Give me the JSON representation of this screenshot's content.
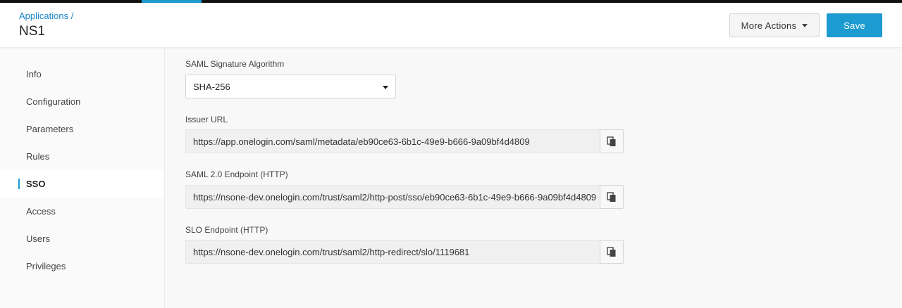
{
  "header": {
    "breadcrumb": "Applications /",
    "title": "NS1",
    "more_actions_label": "More Actions",
    "save_label": "Save"
  },
  "sidebar": {
    "items": [
      {
        "label": "Info",
        "active": false
      },
      {
        "label": "Configuration",
        "active": false
      },
      {
        "label": "Parameters",
        "active": false
      },
      {
        "label": "Rules",
        "active": false
      },
      {
        "label": "SSO",
        "active": true
      },
      {
        "label": "Access",
        "active": false
      },
      {
        "label": "Users",
        "active": false
      },
      {
        "label": "Privileges",
        "active": false
      }
    ]
  },
  "sso": {
    "signature_label": "SAML Signature Algorithm",
    "signature_value": "SHA-256",
    "issuer_label": "Issuer URL",
    "issuer_value": "https://app.onelogin.com/saml/metadata/eb90ce63-6b1c-49e9-b666-9a09bf4d4809",
    "saml_endpoint_label": "SAML 2.0 Endpoint (HTTP)",
    "saml_endpoint_value": "https://nsone-dev.onelogin.com/trust/saml2/http-post/sso/eb90ce63-6b1c-49e9-b666-9a09bf4d4809",
    "slo_label": "SLO Endpoint (HTTP)",
    "slo_value": "https://nsone-dev.onelogin.com/trust/saml2/http-redirect/slo/1119681"
  },
  "icons": {
    "copy": "copy-icon",
    "dropdown": "caret-down-icon"
  },
  "colors": {
    "accent": "#1c9bd1",
    "topbar": "#111111",
    "link": "#1a86c6"
  }
}
